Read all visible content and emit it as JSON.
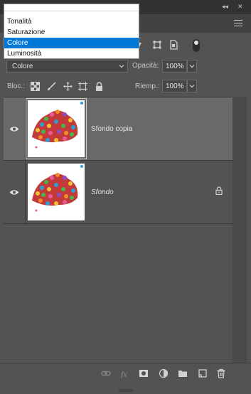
{
  "window": {
    "collapse_glyph": "◂◂",
    "close_glyph": "✕"
  },
  "blend": {
    "value": "Colore"
  },
  "opacity": {
    "label": "Opacità:",
    "value": "100%"
  },
  "lock": {
    "label": "Bloc.:"
  },
  "fill": {
    "label": "Riemp.:",
    "value": "100%"
  },
  "layers": [
    {
      "name": "Sfondo copia",
      "selected": true,
      "italic": false,
      "locked": false
    },
    {
      "name": "Sfondo",
      "selected": false,
      "italic": true,
      "locked": true
    }
  ],
  "dropdown": {
    "items": [
      {
        "label": "Tonalità",
        "active": false
      },
      {
        "label": "Saturazione",
        "active": false
      },
      {
        "label": "Colore",
        "active": true
      },
      {
        "label": "Luminosità",
        "active": false
      }
    ]
  },
  "colors": {
    "panel": "#535353",
    "selected_layer": "#696969",
    "highlight": "#0078d7"
  },
  "icons": [
    "eye-icon",
    "lock-icon",
    "link-icon",
    "fx-icon",
    "mask-icon",
    "adjustment-icon",
    "folder-icon",
    "new-layer-icon",
    "trash-icon",
    "panel-menu-icon"
  ]
}
